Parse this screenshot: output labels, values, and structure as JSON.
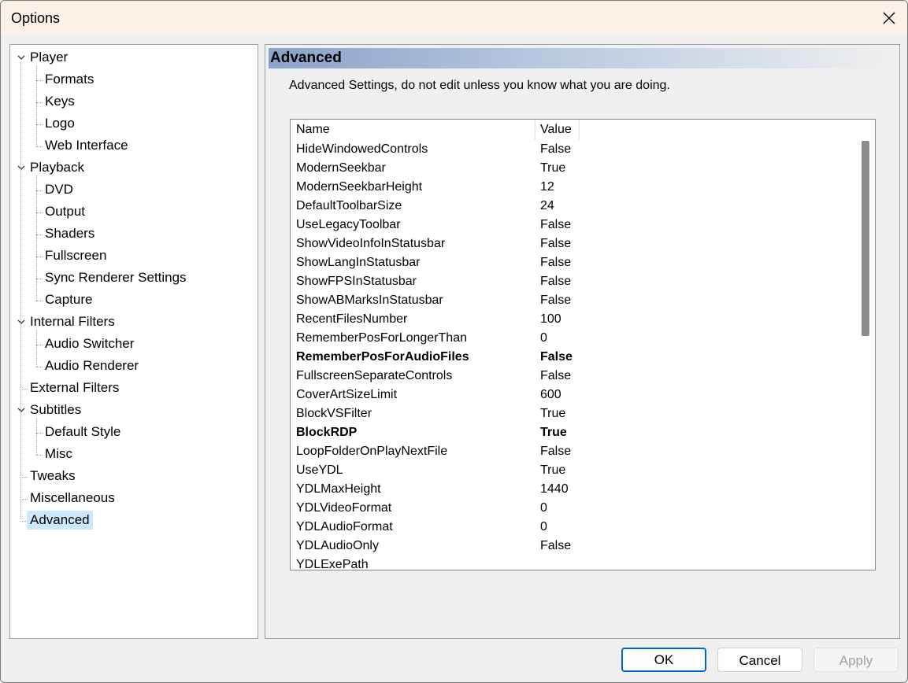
{
  "window": {
    "title": "Options"
  },
  "tree": [
    {
      "label": "Player",
      "level": 0,
      "expanded": true
    },
    {
      "label": "Formats",
      "level": 1
    },
    {
      "label": "Keys",
      "level": 1
    },
    {
      "label": "Logo",
      "level": 1
    },
    {
      "label": "Web Interface",
      "level": 1
    },
    {
      "label": "Playback",
      "level": 0,
      "expanded": true
    },
    {
      "label": "DVD",
      "level": 1
    },
    {
      "label": "Output",
      "level": 1
    },
    {
      "label": "Shaders",
      "level": 1
    },
    {
      "label": "Fullscreen",
      "level": 1
    },
    {
      "label": "Sync Renderer Settings",
      "level": 1
    },
    {
      "label": "Capture",
      "level": 1
    },
    {
      "label": "Internal Filters",
      "level": 0,
      "expanded": true
    },
    {
      "label": "Audio Switcher",
      "level": 1
    },
    {
      "label": "Audio Renderer",
      "level": 1
    },
    {
      "label": "External Filters",
      "level": 0
    },
    {
      "label": "Subtitles",
      "level": 0,
      "expanded": true
    },
    {
      "label": "Default Style",
      "level": 1
    },
    {
      "label": "Misc",
      "level": 1
    },
    {
      "label": "Tweaks",
      "level": 0
    },
    {
      "label": "Miscellaneous",
      "level": 0
    },
    {
      "label": "Advanced",
      "level": 0,
      "selected": true
    }
  ],
  "page": {
    "header": "Advanced",
    "description": "Advanced Settings, do not edit unless you know what you are doing."
  },
  "list": {
    "columns": [
      "Name",
      "Value"
    ],
    "rows": [
      {
        "name": "HideWindowedControls",
        "value": "False"
      },
      {
        "name": "ModernSeekbar",
        "value": "True"
      },
      {
        "name": "ModernSeekbarHeight",
        "value": "12"
      },
      {
        "name": "DefaultToolbarSize",
        "value": "24"
      },
      {
        "name": "UseLegacyToolbar",
        "value": "False"
      },
      {
        "name": "ShowVideoInfoInStatusbar",
        "value": "False"
      },
      {
        "name": "ShowLangInStatusbar",
        "value": "False"
      },
      {
        "name": "ShowFPSInStatusbar",
        "value": "False"
      },
      {
        "name": "ShowABMarksInStatusbar",
        "value": "False"
      },
      {
        "name": "RecentFilesNumber",
        "value": "100"
      },
      {
        "name": "RememberPosForLongerThan",
        "value": "0"
      },
      {
        "name": "RememberPosForAudioFiles",
        "value": "False",
        "modified": true
      },
      {
        "name": "FullscreenSeparateControls",
        "value": "False"
      },
      {
        "name": "CoverArtSizeLimit",
        "value": "600"
      },
      {
        "name": "BlockVSFilter",
        "value": "True"
      },
      {
        "name": "BlockRDP",
        "value": "True",
        "modified": true
      },
      {
        "name": "LoopFolderOnPlayNextFile",
        "value": "False"
      },
      {
        "name": "UseYDL",
        "value": "True"
      },
      {
        "name": "YDLMaxHeight",
        "value": "1440"
      },
      {
        "name": "YDLVideoFormat",
        "value": "0"
      },
      {
        "name": "YDLAudioFormat",
        "value": "0"
      },
      {
        "name": "YDLAudioOnly",
        "value": "False"
      },
      {
        "name": "YDLExePath",
        "value": ""
      }
    ]
  },
  "buttons": {
    "ok": "OK",
    "cancel": "Cancel",
    "apply": "Apply"
  },
  "colors": {
    "selection": "#cce8ff",
    "accent": "#0067c0",
    "header_gradient_start": "#8aa3c9"
  }
}
